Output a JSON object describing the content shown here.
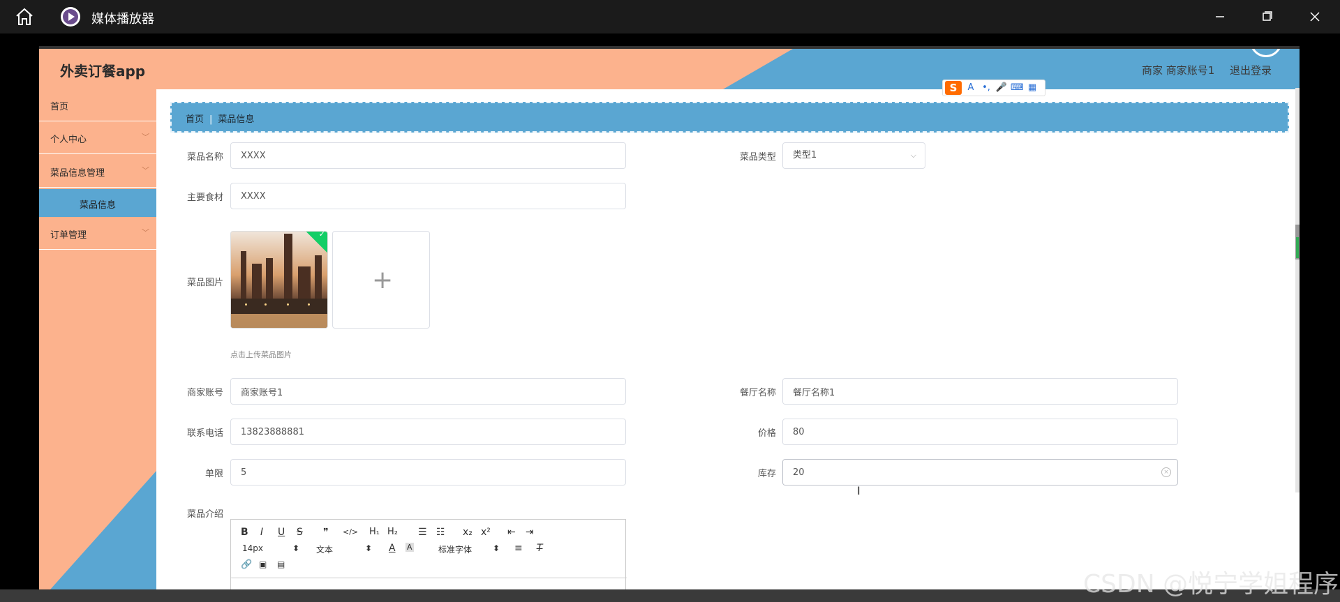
{
  "player": {
    "title": "媒体播放器"
  },
  "header": {
    "brand": "外卖订餐app",
    "user_info": "商家 商家账号1",
    "logout": "退出登录"
  },
  "ime": {
    "logo": "S",
    "items": [
      "A",
      "•,",
      "🎤",
      "⌨",
      "▦"
    ]
  },
  "sidebar": {
    "items": [
      {
        "label": "首页"
      },
      {
        "label": "个人中心",
        "chevron": "﹀"
      },
      {
        "label": "菜品信息管理",
        "chevron": "﹀"
      },
      {
        "label": "订单管理",
        "chevron": "﹀"
      }
    ],
    "active_sub": "菜品信息"
  },
  "breadcrumb": {
    "home": "首页",
    "separator": "|",
    "current": "菜品信息"
  },
  "form": {
    "dish_name": {
      "label": "菜品名称",
      "value": "XXXX"
    },
    "dish_type": {
      "label": "菜品类型",
      "value": "类型1"
    },
    "main_ingredients": {
      "label": "主要食材",
      "value": "XXXX"
    },
    "dish_image": {
      "label": "菜品图片",
      "hint": "点击上传菜品图片",
      "plus": "+"
    },
    "merchant_account": {
      "label": "商家账号",
      "value": "商家账号1"
    },
    "restaurant_name": {
      "label": "餐厅名称",
      "value": "餐厅名称1"
    },
    "phone": {
      "label": "联系电话",
      "value": "13823888881"
    },
    "price": {
      "label": "价格",
      "value": "80"
    },
    "limit": {
      "label": "单限",
      "value": "5"
    },
    "stock": {
      "label": "库存",
      "value": "20"
    },
    "description": {
      "label": "菜品介绍"
    }
  },
  "editor": {
    "row1": [
      "B",
      "I",
      "U",
      "S",
      "❞",
      "</>",
      "H₁",
      "H₂",
      "☰",
      "☷",
      "x₂",
      "x²",
      "⇤",
      "⇥"
    ],
    "font_size": "14px",
    "block_type": "文本",
    "font_family": "标准字体",
    "updown": "⬍"
  },
  "watermark": "CSDN @悦宁学姐程序"
}
